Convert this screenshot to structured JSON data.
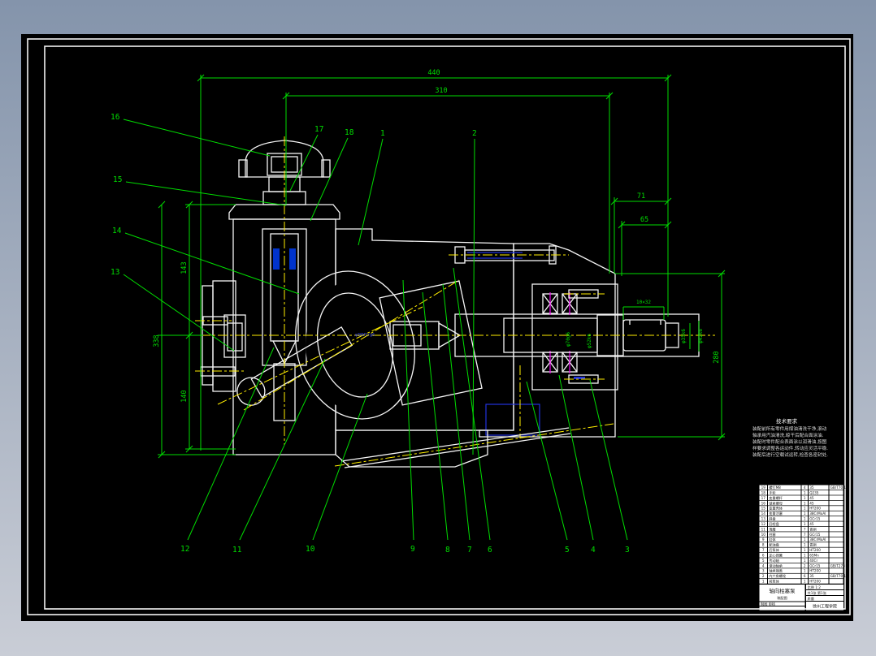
{
  "window": {
    "bg_top": "#8494ab",
    "bg_bottom": "#c9cdd6",
    "sheet_bg": "#000000",
    "frame_color": "#f2f2f2"
  },
  "colors": {
    "dimension_green": "#00dd00",
    "hatch_cyan": "#23e8e8",
    "centerline_yellow": "#ffee00",
    "detail_blue": "#2233dd",
    "bearing_magenta": "#ee00ee",
    "outline_white": "#f5f5f5"
  },
  "dims": {
    "d440": "440",
    "d310": "310",
    "d71": "71",
    "d65": "65",
    "d10x32": "10×32",
    "d280": "280",
    "d143": "143",
    "d338": "338",
    "d140": "140",
    "dphi70": "φ70g6",
    "dphi52": "φ52k6",
    "dphi35": "φ35k6",
    "dphi42": "φ42k6",
    "dphi30": "φ30H7/g6"
  },
  "callouts": {
    "c1": "1",
    "c2": "2",
    "c3": "3",
    "c4": "4",
    "c5": "5",
    "c6": "6",
    "c7": "7",
    "c8": "8",
    "c9": "9",
    "c10": "10",
    "c11": "11",
    "c12": "12",
    "c13": "13",
    "c14": "14",
    "c15": "15",
    "c16": "16",
    "c17": "17",
    "c18": "18"
  },
  "notes": {
    "title": "技术要求",
    "lines": [
      "装配前所有零件用煤油清洗干净,滚动",
      "轴承用汽油清洗,晾干后配合面涂油.",
      "装配时零件配合表面涂以润滑油,按图",
      "样要求调整各运动件,转动应灵活平稳.",
      "装配后进行空载试运转,检查各密封处."
    ]
  },
  "bom": {
    "rows": [
      {
        "no": "19",
        "name": "螺钉M8",
        "qty": "4",
        "mat": "35",
        "remark": "GB/T70.1"
      },
      {
        "no": "18",
        "name": "手轮",
        "qty": "1",
        "mat": "Q235",
        "remark": ""
      },
      {
        "no": "17",
        "name": "变量螺杆",
        "qty": "1",
        "mat": "45",
        "remark": ""
      },
      {
        "no": "16",
        "name": "锁紧螺母",
        "qty": "1",
        "mat": "45",
        "remark": ""
      },
      {
        "no": "15",
        "name": "变量壳体",
        "qty": "1",
        "mat": "HT200",
        "remark": ""
      },
      {
        "no": "14",
        "name": "变量活塞",
        "qty": "1",
        "mat": "38CrMoAl",
        "remark": ""
      },
      {
        "no": "13",
        "name": "斜盘",
        "qty": "1",
        "mat": "GCr15",
        "remark": ""
      },
      {
        "no": "12",
        "name": "回程盘",
        "qty": "1",
        "mat": "45",
        "remark": ""
      },
      {
        "no": "11",
        "name": "滑履",
        "qty": "7",
        "mat": "青铜",
        "remark": ""
      },
      {
        "no": "10",
        "name": "柱塞",
        "qty": "7",
        "mat": "GCr15",
        "remark": ""
      },
      {
        "no": "9",
        "name": "缸体",
        "qty": "1",
        "mat": "38CrMoAl",
        "remark": ""
      },
      {
        "no": "8",
        "name": "配油盘",
        "qty": "1",
        "mat": "青铜",
        "remark": ""
      },
      {
        "no": "7",
        "name": "后泵体",
        "qty": "1",
        "mat": "HT200",
        "remark": ""
      },
      {
        "no": "6",
        "name": "定心弹簧",
        "qty": "1",
        "mat": "65Mn",
        "remark": ""
      },
      {
        "no": "5",
        "name": "传动轴",
        "qty": "1",
        "mat": "40Cr",
        "remark": ""
      },
      {
        "no": "4",
        "name": "滚动轴承",
        "qty": "2",
        "mat": "GCr15",
        "remark": "GB/T276"
      },
      {
        "no": "3",
        "name": "轴承端盖",
        "qty": "1",
        "mat": "HT200",
        "remark": ""
      },
      {
        "no": "2",
        "name": "内六角螺栓",
        "qty": "6",
        "mat": "35",
        "remark": "GB/T70.1"
      },
      {
        "no": "1",
        "name": "前泵体",
        "qty": "1",
        "mat": "HT200",
        "remark": ""
      }
    ],
    "title_block": {
      "title": "轴向柱塞泵",
      "subtitle": "装配图",
      "drawn_row": "制图    审核",
      "scale_row": "比例 1:2",
      "sheet_row": "共1张 第1张",
      "mass_row": "质量",
      "school": "徐州工程学院"
    }
  }
}
